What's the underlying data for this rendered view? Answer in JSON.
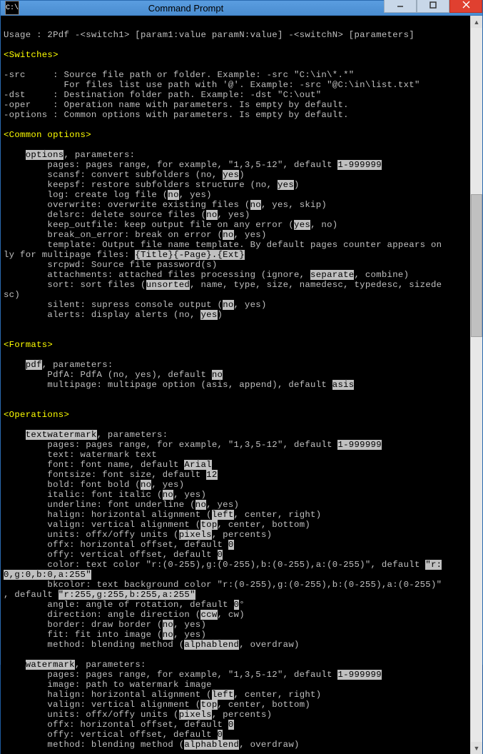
{
  "window": {
    "title": "Command Prompt",
    "icon_text": "C:\\"
  },
  "usage": "Usage : 2Pdf -<switch1> [param1:value paramN:value] -<switchN> [parameters]",
  "sections": {
    "switches": {
      "header": "<Switches>",
      "src1": "-src     : Source file path or folder. Example: -src \"C:\\in\\*.*\"",
      "src2": "           For files list use path with '@'. Example: -src \"@C:\\in\\list.txt\"",
      "dst": "-dst     : Destination folder path. Example: -dst \"C:\\out\"",
      "oper": "-oper    : Operation name with parameters. Is empty by default.",
      "opts": "-options : Common options with parameters. Is empty by default."
    },
    "common": {
      "header": "<Common options>",
      "title": "options",
      "params_label": ", parameters:",
      "pages": {
        "pre": "        pages: pages range, for example, \"1,3,5-12\", default ",
        "def": "1-999999"
      },
      "scansf": {
        "pre": "        scansf: convert subfolders (no, ",
        "def": "yes",
        "post": ")"
      },
      "keepsf": {
        "pre": "        keepsf: restore subfolders structure (no, ",
        "def": "yes",
        "post": ")"
      },
      "log": {
        "pre": "        log: create log file (",
        "def": "no",
        "post": ", yes)"
      },
      "overwrite": {
        "pre": "        overwrite: overwrite existing files (",
        "def": "no",
        "post": ", yes, skip)"
      },
      "delsrc": {
        "pre": "        delsrc: delete source files (",
        "def": "no",
        "post": ", yes)"
      },
      "keepout": {
        "pre": "        keep_outfile: keep output file on any error (",
        "def": "yes",
        "post": ", no)"
      },
      "boe": {
        "pre": "        break_on_error: break on error (",
        "def": "no",
        "post": ", yes)"
      },
      "template1": "        template: Output file name template. By default pages counter appears on",
      "template2a": "ly for multipage files: ",
      "template2b": "{Title}{-Page}.{Ext}",
      "srcpwd": "        srcpwd: Source file password(s)",
      "attach": {
        "pre": "        attachments: attached files processing (ignore, ",
        "def": "separate",
        "post": ", combine)"
      },
      "sort1": {
        "pre": "        sort: sort files (",
        "def": "unsorted",
        "post": ", name, type, size, namedesc, typedesc, sizede"
      },
      "sort2": "sc)",
      "silent": {
        "pre": "        silent: supress console output (",
        "def": "no",
        "post": ", yes)"
      },
      "alerts": {
        "pre": "        alerts: display alerts (no, ",
        "def": "yes",
        "post": ")"
      }
    },
    "formats": {
      "header": "<Formats>",
      "title": "pdf",
      "params_label": ", parameters:",
      "pdfa": {
        "pre": "        PdfA: PdfA (no, yes), default ",
        "def": "no"
      },
      "multipage": {
        "pre": "        multipage: multipage option (asis, append), default ",
        "def": "asis"
      }
    },
    "operations": {
      "header": "<Operations>",
      "tw": {
        "title": "textwatermark",
        "params_label": ", parameters:",
        "pages": {
          "pre": "        pages: pages range, for example, \"1,3,5-12\", default ",
          "def": "1-999999"
        },
        "text": "        text: watermark text",
        "font": {
          "pre": "        font: font name, default ",
          "def": "Arial"
        },
        "fontsize": {
          "pre": "        fontsize: font size, default ",
          "def": "12"
        },
        "bold": {
          "pre": "        bold: font bold (",
          "def": "no",
          "post": ", yes)"
        },
        "italic": {
          "pre": "        italic: font italic (",
          "def": "no",
          "post": ", yes)"
        },
        "underline": {
          "pre": "        underline: font underline (",
          "def": "no",
          "post": ", yes)"
        },
        "halign": {
          "pre": "        halign: horizontal alignment (",
          "def": "left",
          "post": ", center, right)"
        },
        "valign": {
          "pre": "        valign: vertical alignment (",
          "def": "top",
          "post": ", center, bottom)"
        },
        "units": {
          "pre": "        units: offx/offy units (",
          "def": "pixels",
          "post": ", percents)"
        },
        "offx": {
          "pre": "        offx: horizontal offset, default ",
          "def": "0"
        },
        "offy": {
          "pre": "        offy: vertical offset, default ",
          "def": "0"
        },
        "color1": {
          "pre": "        color: text color \"r:(0-255),g:(0-255),b:(0-255),a:(0-255)\", default ",
          "def": "\"r:"
        },
        "color2": {
          "def": "0,g:0,b:0,a:255\""
        },
        "bkcolor1": "        bkcolor: text background color \"r:(0-255),g:(0-255),b:(0-255),a:(0-255)\"",
        "bkcolor2a": ", default ",
        "bkcolor2b": "\"r:255,g:255,b:255,a:255\"",
        "angle": {
          "pre": "        angle: angle of rotation, default ",
          "def": "0",
          "deg": "°"
        },
        "direction": {
          "pre": "        direction: angle direction (",
          "def": "ccw",
          "post": ", cw)"
        },
        "border": {
          "pre": "        border: draw border (",
          "def": "no",
          "post": ", yes)"
        },
        "fit": {
          "pre": "        fit: fit into image (",
          "def": "no",
          "post": ", yes)"
        },
        "method": {
          "pre": "        method: blending method (",
          "def": "alphablend",
          "post": ", overdraw)"
        }
      },
      "wm": {
        "title": "watermark",
        "params_label": ", parameters:",
        "pages": {
          "pre": "        pages: pages range, for example, \"1,3,5-12\", default ",
          "def": "1-999999"
        },
        "image": "        image: path to watermark image",
        "halign": {
          "pre": "        halign: horizontal alignment (",
          "def": "left",
          "post": ", center, right)"
        },
        "valign": {
          "pre": "        valign: vertical alignment (",
          "def": "top",
          "post": ", center, bottom)"
        },
        "units": {
          "pre": "        units: offx/offy units (",
          "def": "pixels",
          "post": ", percents)"
        },
        "offx": {
          "pre": "        offx: horizontal offset, default ",
          "def": "0"
        },
        "offy": {
          "pre": "        offy: vertical offset, default ",
          "def": "0"
        },
        "method": {
          "pre": "        method: blending method (",
          "def": "alphablend",
          "post": ", overdraw)"
        }
      }
    }
  }
}
